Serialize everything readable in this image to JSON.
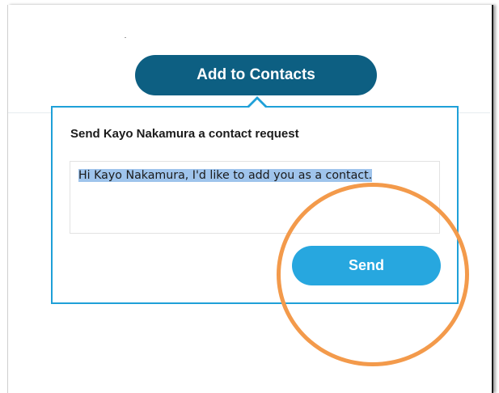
{
  "add_contacts": {
    "label": "Add to Contacts"
  },
  "contact_request": {
    "title": "Send Kayo Nakamura a contact request",
    "message": "Hi Kayo Nakamura, I'd like to add you as a contact.",
    "send_label": "Send"
  },
  "colors": {
    "add_button": "#0d5f82",
    "popup_border": "#1fa0d8",
    "send_button": "#27a7df",
    "selection": "#9fc4ec",
    "annotation_circle": "#f39a4b"
  }
}
